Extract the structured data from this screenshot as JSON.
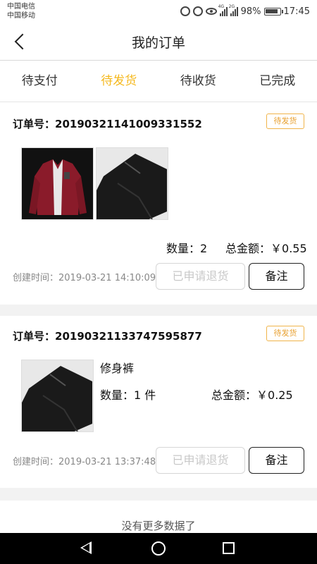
{
  "status_bar": {
    "carrier_1": "中国电信",
    "carrier_2": "中国移动",
    "net_1": "4G",
    "net_2": "2G",
    "battery": "98%",
    "time": "17:45"
  },
  "header": {
    "title": "我的订单"
  },
  "tabs": [
    {
      "label": "待支付",
      "active": false
    },
    {
      "label": "待发货",
      "active": true
    },
    {
      "label": "待收货",
      "active": false
    },
    {
      "label": "已完成",
      "active": false
    }
  ],
  "orders": [
    {
      "order_label": "订单号：",
      "order_no": "20190321141009331552",
      "status": "待发货",
      "quantity_text": "数量：2",
      "total_label": "总金额：",
      "total": "￥0.55",
      "created_label": "创建时间：",
      "created_time": "2019-03-21 14:10:09",
      "refund_button": "已申请退货",
      "note_button": "备注"
    },
    {
      "order_label": "订单号：",
      "order_no": "20190321133747595877",
      "status": "待发货",
      "product_name": "修身裤",
      "quantity_text": "数量：1 件",
      "total_label": "总金额：",
      "total": "￥0.25",
      "created_label": "创建时间：",
      "created_time": "2019-03-21 13:37:48",
      "refund_button": "已申请退货",
      "note_button": "备注"
    }
  ],
  "footer": {
    "no_more": "没有更多数据了"
  },
  "colors": {
    "accent": "#f5b81c",
    "badge_border": "#f0b44a",
    "background_gap": "#f2f2f2"
  }
}
